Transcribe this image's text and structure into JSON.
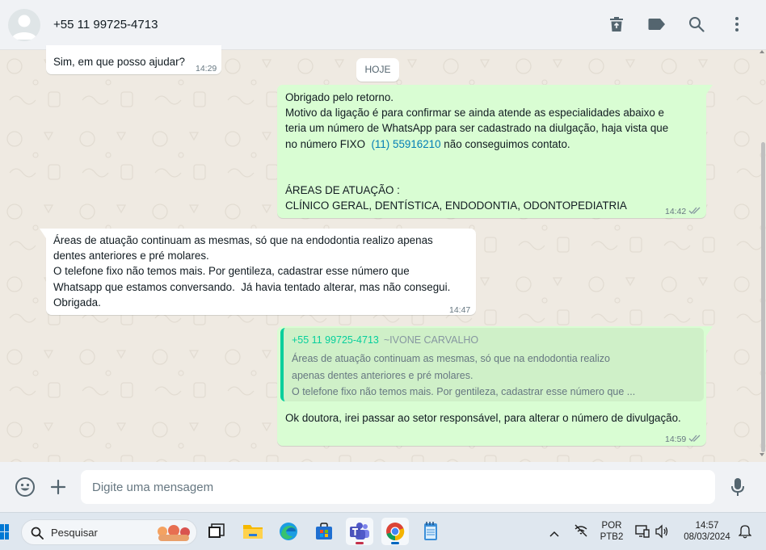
{
  "header": {
    "contact_name": "+55 11 99725-4713",
    "icons": [
      "delete-icon",
      "label-icon",
      "search-icon",
      "menu-icon"
    ]
  },
  "chat": {
    "date_chip": "HOJE",
    "messages": [
      {
        "direction": "incoming",
        "text": "Sim, em que posso ajudar?",
        "time": "14:29"
      },
      {
        "direction": "outgoing",
        "lines": [
          "Obrigado pelo retorno.",
          "Motivo da ligação é para confirmar se ainda atende as especialidades abaixo e",
          "teria um número de WhatsApp para ser cadastrado na diulgação, haja vista que",
          "no número FIXO ",
          "(11) 55916210",
          " não conseguimos contato.",
          "ÁREAS DE ATUAÇÃO :",
          "CLÍNICO GERAL, DENTÍSTICA, ENDODONTIA, ODONTOPEDIATRIA"
        ],
        "time": "14:42",
        "status": "read"
      },
      {
        "direction": "incoming",
        "lines": [
          "Áreas de atuação continuam as mesmas, só que na endodontia realizo apenas",
          "dentes anteriores e pré molares.",
          "O telefone fixo não temos mais. Por gentileza, cadastrar esse número que",
          "Whatsapp que estamos conversando.  Já havia tentado alterar, mas não consegui.",
          "Obrigada."
        ],
        "time": "14:47"
      },
      {
        "direction": "outgoing",
        "quote": {
          "author": "+55 11 99725-4713",
          "author_alias": "~IVONE CARVALHO",
          "lines": [
            "Áreas de atuação continuam as mesmas, só que na endodontia realizo",
            "apenas dentes anteriores e pré molares.",
            "O telefone fixo não temos mais. Por gentileza, cadastrar esse número que ..."
          ]
        },
        "text": "Ok doutora, irei passar ao setor responsável, para alterar o número de divulgação.",
        "time": "14:59",
        "status": "read"
      }
    ]
  },
  "composer": {
    "placeholder": "Digite uma mensagem",
    "icons": [
      "emoji-icon",
      "attach-plus-icon",
      "microphone-icon"
    ]
  },
  "taskbar": {
    "search_placeholder": "Pesquisar",
    "apps": [
      "task-view",
      "file-explorer",
      "edge",
      "microsoft-store",
      "teams",
      "chrome",
      "notepad"
    ],
    "language_line1": "POR",
    "language_line2": "PTB2",
    "clock_time": "14:57",
    "clock_date": "08/03/2024"
  },
  "colors": {
    "header_bg": "#f0f2f5",
    "chat_bg": "#efeae2",
    "incoming_bubble": "#ffffff",
    "outgoing_bubble": "#d9fdd3",
    "link": "#027eb5",
    "quote_accent": "#06cf9c",
    "read_ticks": "#8696a0"
  }
}
